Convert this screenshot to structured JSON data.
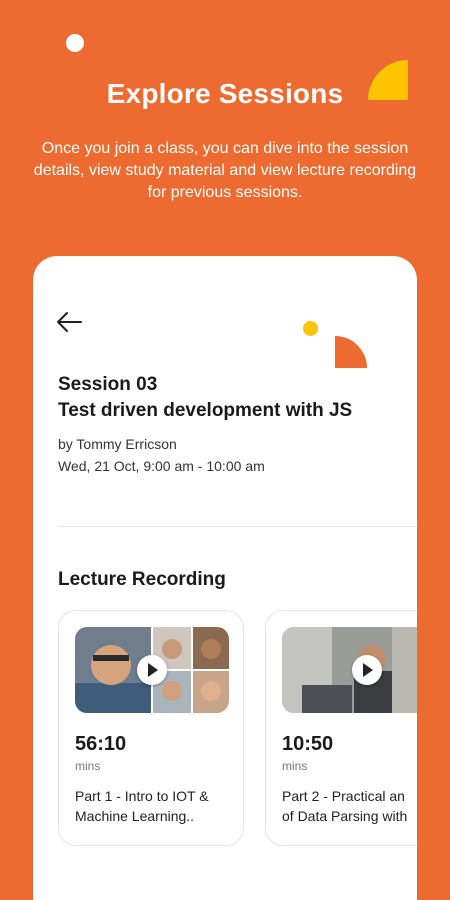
{
  "hero": {
    "title": "Explore Sessions",
    "description": "Once you join a class, you can dive into the session details, view study material and view lecture recording for previous sessions."
  },
  "session": {
    "number": "Session 03",
    "title": "Test driven development with JS",
    "instructor": "by Tommy Erricson",
    "datetime": "Wed, 21 Oct, 9:00 am - 10:00 am"
  },
  "recordings": {
    "section_title": "Lecture Recording",
    "items": [
      {
        "duration": "56:10",
        "unit": "mins",
        "line1": "Part 1 - Intro to IOT &",
        "line2": "Machine Learning.."
      },
      {
        "duration": "10:50",
        "unit": "mins",
        "line1": "Part 2 - Practical an",
        "line2": "of Data Parsing with"
      }
    ]
  },
  "colors": {
    "background": "#ED6A30",
    "accent_yellow": "#FFC400",
    "card": "#FFFFFF"
  },
  "icons": {
    "back": "arrow-left-icon",
    "play": "play-icon"
  }
}
